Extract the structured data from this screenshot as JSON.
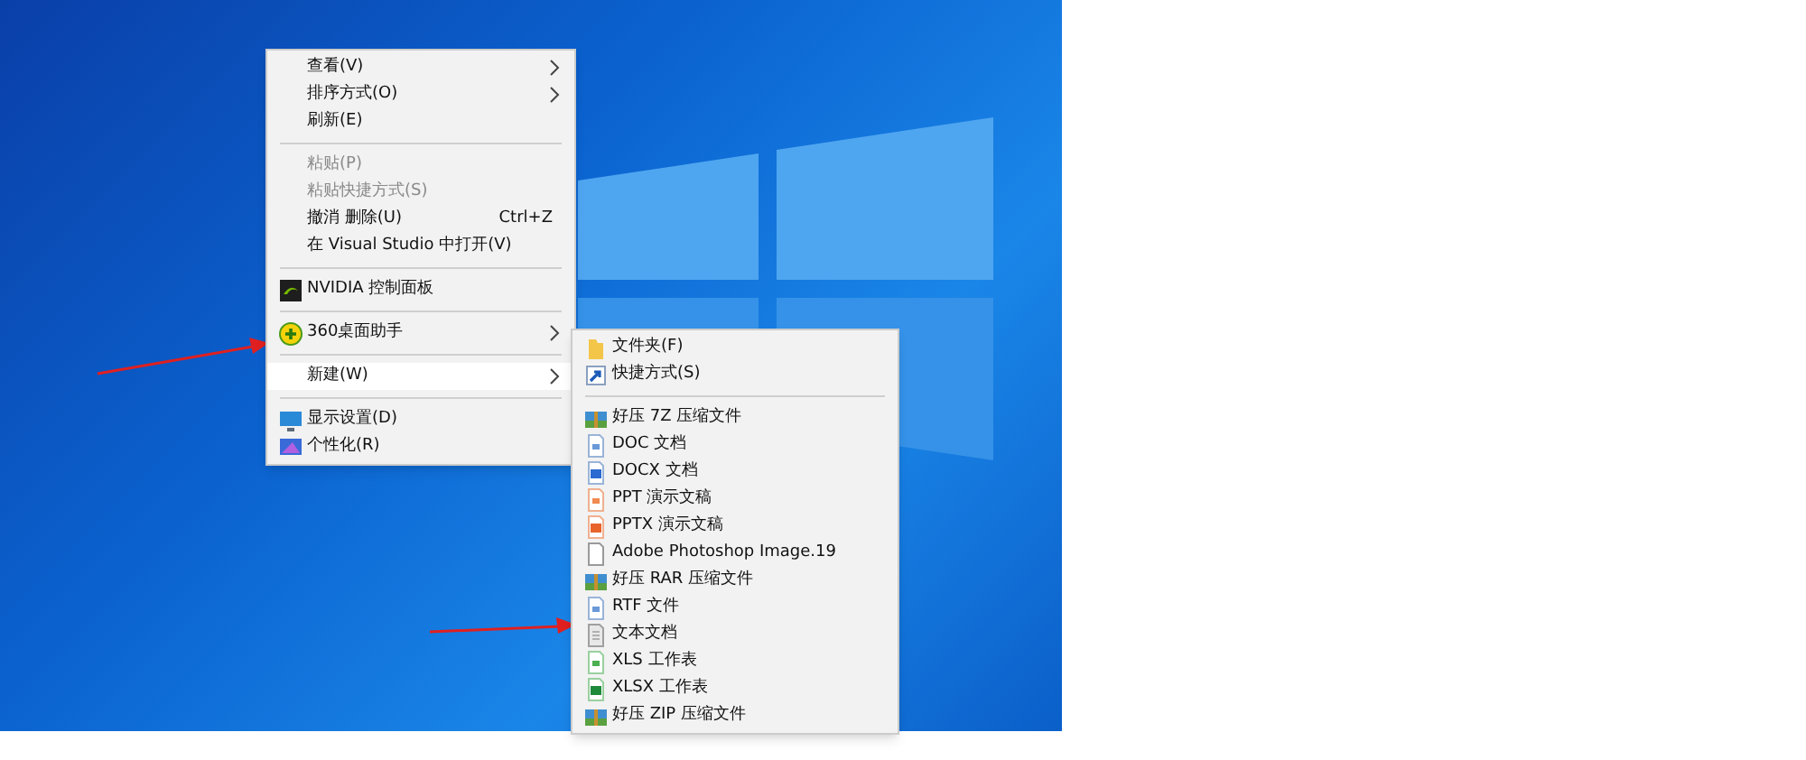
{
  "context_menu": {
    "items": [
      {
        "kind": "item",
        "label": "查看(V)",
        "submenu": true,
        "disabled": false,
        "selected": false
      },
      {
        "kind": "item",
        "label": "排序方式(O)",
        "submenu": true,
        "disabled": false,
        "selected": false
      },
      {
        "kind": "item",
        "label": "刷新(E)",
        "submenu": false,
        "disabled": false,
        "selected": false
      },
      {
        "kind": "separator"
      },
      {
        "kind": "item",
        "label": "粘贴(P)",
        "submenu": false,
        "disabled": true,
        "selected": false
      },
      {
        "kind": "item",
        "label": "粘贴快捷方式(S)",
        "submenu": false,
        "disabled": true,
        "selected": false
      },
      {
        "kind": "item",
        "label": "撤消 删除(U)",
        "shortcut": "Ctrl+Z",
        "submenu": false,
        "disabled": false,
        "selected": false
      },
      {
        "kind": "item",
        "label": "在 Visual Studio 中打开(V)",
        "submenu": false,
        "disabled": false,
        "selected": false
      },
      {
        "kind": "separator"
      },
      {
        "kind": "item",
        "label": "NVIDIA 控制面板",
        "submenu": false,
        "disabled": false,
        "selected": false
      },
      {
        "kind": "separator"
      },
      {
        "kind": "item",
        "label": "360桌面助手",
        "submenu": true,
        "disabled": false,
        "selected": false
      },
      {
        "kind": "separator"
      },
      {
        "kind": "item",
        "label": "新建(W)",
        "submenu": true,
        "disabled": false,
        "selected": true
      },
      {
        "kind": "separator"
      },
      {
        "kind": "item",
        "label": "显示设置(D)",
        "submenu": false,
        "disabled": false,
        "selected": false
      },
      {
        "kind": "item",
        "label": "个性化(R)",
        "submenu": false,
        "disabled": false,
        "selected": false
      }
    ]
  },
  "new_submenu": {
    "items": [
      {
        "kind": "item",
        "label": "文件夹(F)"
      },
      {
        "kind": "item",
        "label": "快捷方式(S)"
      },
      {
        "kind": "separator"
      },
      {
        "kind": "item",
        "label": "好压 7Z 压缩文件"
      },
      {
        "kind": "item",
        "label": "DOC 文档"
      },
      {
        "kind": "item",
        "label": "DOCX 文档"
      },
      {
        "kind": "item",
        "label": "PPT 演示文稿"
      },
      {
        "kind": "item",
        "label": "PPTX 演示文稿"
      },
      {
        "kind": "item",
        "label": "Adobe Photoshop Image.19"
      },
      {
        "kind": "item",
        "label": "好压 RAR 压缩文件"
      },
      {
        "kind": "item",
        "label": "RTF 文件"
      },
      {
        "kind": "item",
        "label": "文本文档"
      },
      {
        "kind": "item",
        "label": "XLS 工作表"
      },
      {
        "kind": "item",
        "label": "XLSX 工作表"
      },
      {
        "kind": "item",
        "label": "好压 ZIP 压缩文件"
      }
    ]
  }
}
